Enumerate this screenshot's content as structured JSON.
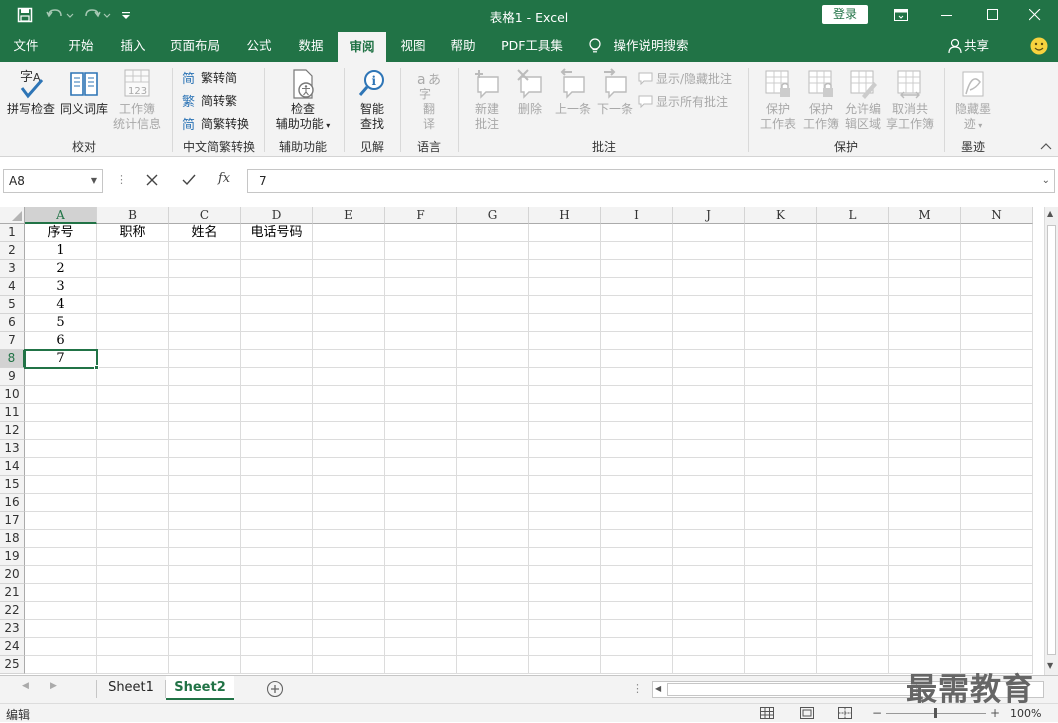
{
  "titlebar": {
    "title": "表格1 - Excel",
    "login_label": "登录"
  },
  "tabs": [
    {
      "label": "文件"
    },
    {
      "label": "开始"
    },
    {
      "label": "插入"
    },
    {
      "label": "页面布局"
    },
    {
      "label": "公式"
    },
    {
      "label": "数据"
    },
    {
      "label": "审阅",
      "active": true
    },
    {
      "label": "视图"
    },
    {
      "label": "帮助"
    },
    {
      "label": "PDF工具集"
    },
    {
      "label": "操作说明搜索"
    }
  ],
  "share_label": "共享",
  "ribbon": {
    "proofing": {
      "spell": "拼写检查",
      "thesaurus": "同义词库",
      "stats_line1": "工作簿",
      "stats_line2": "统计信息",
      "group": "校对"
    },
    "chinese": {
      "to_trad": "繁转简",
      "to_simp": "简转繁",
      "convert": "简繁转换",
      "group": "中文简繁转换"
    },
    "access": {
      "line1": "检查",
      "line2": "辅助功能",
      "group": "辅助功能"
    },
    "insights": {
      "line1": "智能",
      "line2": "查找",
      "group": "见解"
    },
    "language": {
      "line1": "翻",
      "line2": "译",
      "group": "语言"
    },
    "comments": {
      "new_line1": "新建",
      "new_line2": "批注",
      "delete": "删除",
      "prev": "上一条",
      "next": "下一条",
      "show_hide": "显示/隐藏批注",
      "show_all": "显示所有批注",
      "group": "批注"
    },
    "protect": {
      "sheet_line1": "保护",
      "sheet_line2": "工作表",
      "book_line1": "保护",
      "book_line2": "工作簿",
      "range_line1": "允许编",
      "range_line2": "辑区域",
      "unshare_line1": "取消共",
      "unshare_line2": "享工作簿",
      "group": "保护"
    },
    "ink": {
      "line1": "隐藏墨",
      "line2": "迹",
      "group": "墨迹"
    }
  },
  "formula_bar": {
    "name_box": "A8",
    "value": "7",
    "fx": "fx"
  },
  "columns": [
    "A",
    "B",
    "C",
    "D",
    "E",
    "F",
    "G",
    "H",
    "I",
    "J",
    "K",
    "L",
    "M",
    "N"
  ],
  "row_numbers": [
    "1",
    "2",
    "3",
    "4",
    "5",
    "6",
    "7",
    "8",
    "9",
    "10",
    "11",
    "12",
    "13",
    "14",
    "15",
    "16",
    "17",
    "18",
    "19",
    "20",
    "21",
    "22",
    "23",
    "24",
    "25"
  ],
  "header_row": [
    "序号",
    "职称",
    "姓名",
    "电话号码"
  ],
  "serials": [
    "1",
    "2",
    "3",
    "4",
    "5",
    "6",
    "7"
  ],
  "selected_cell": "A8",
  "sheets": [
    {
      "label": "Sheet1"
    },
    {
      "label": "Sheet2",
      "active": true
    }
  ],
  "status": {
    "mode": "编辑",
    "zoom": "100%"
  },
  "watermark": "最需教育",
  "colors": {
    "accent": "#217346"
  }
}
